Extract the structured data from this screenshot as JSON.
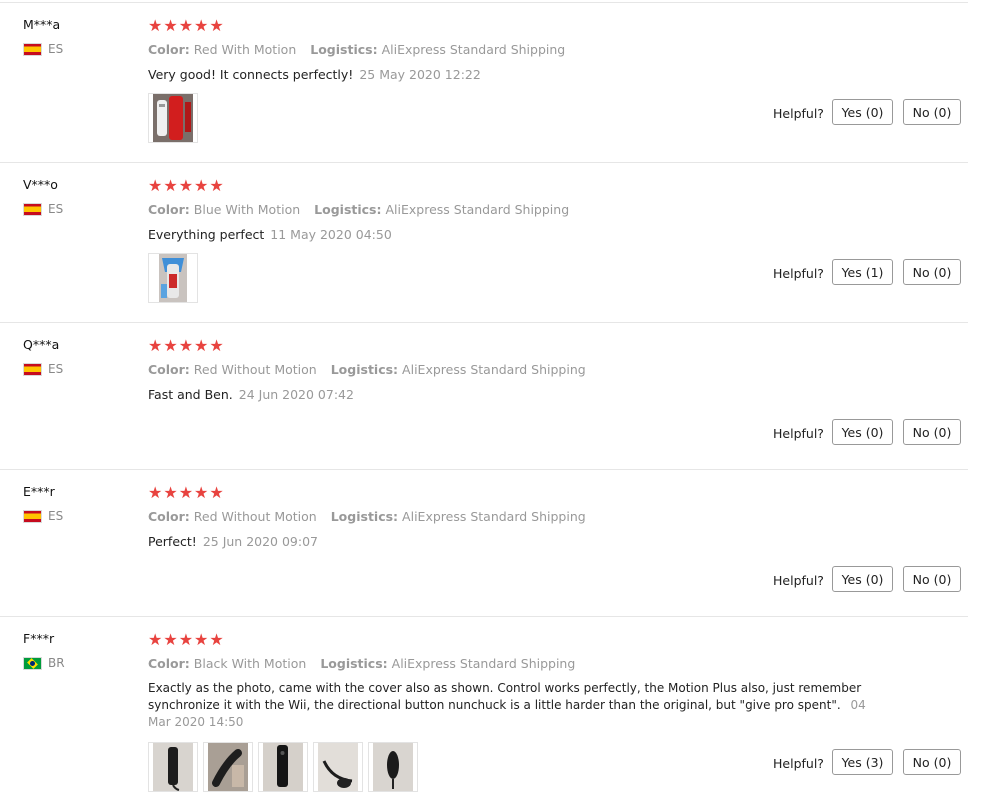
{
  "labels": {
    "color": "Color:",
    "logistics": "Logistics:",
    "helpful": "Helpful?",
    "stars": "★★★★★"
  },
  "reviews": [
    {
      "user": "M***a",
      "country": "ES",
      "flag": "spain-flag",
      "rating": 5,
      "color": "Red With Motion",
      "logistics": "AliExpress Standard Shipping",
      "text": "Very good! It connects perfectly!",
      "date": "25 May 2020 12:22",
      "photos": [
        "red-remote-photo"
      ],
      "yes": "Yes (0)",
      "no": "No (0)"
    },
    {
      "user": "V***o",
      "country": "ES",
      "flag": "spain-flag",
      "rating": 5,
      "color": "Blue With Motion",
      "logistics": "AliExpress Standard Shipping",
      "text": "Everything perfect",
      "date": "11 May 2020 04:50",
      "photos": [
        "blue-remote-photo"
      ],
      "yes": "Yes (1)",
      "no": "No (0)"
    },
    {
      "user": "Q***a",
      "country": "ES",
      "flag": "spain-flag",
      "rating": 5,
      "color": "Red Without Motion",
      "logistics": "AliExpress Standard Shipping",
      "text": "Fast and Ben.",
      "date": "24 Jun 2020 07:42",
      "photos": [],
      "yes": "Yes (0)",
      "no": "No (0)"
    },
    {
      "user": "E***r",
      "country": "ES",
      "flag": "spain-flag",
      "rating": 5,
      "color": "Red Without Motion",
      "logistics": "AliExpress Standard Shipping",
      "text": "Perfect!",
      "date": "25 Jun 2020 09:07",
      "photos": [],
      "yes": "Yes (0)",
      "no": "No (0)"
    },
    {
      "user": "F***r",
      "country": "BR",
      "flag": "brazil-flag",
      "rating": 5,
      "color": "Black With Motion",
      "logistics": "AliExpress Standard Shipping",
      "text_lines": [
        "Exactly as the photo, came with the cover also as shown. Control works perfectly, the Motion Plus also, just remember",
        "synchronize it with the Wii, the directional button nunchuck is a little harder than the original, but \"give pro spent\".",
        "Mar 2020 14:50"
      ],
      "date_part": "04",
      "photos": [
        "black-remote-photo-1",
        "black-remote-photo-2",
        "black-remote-photo-3",
        "black-remote-photo-4",
        "black-remote-photo-5"
      ],
      "yes": "Yes (3)",
      "no": "No (0)"
    }
  ],
  "colors": {
    "star": "#e8433f",
    "muted": "#999999",
    "separator": "#e6e6e6"
  }
}
